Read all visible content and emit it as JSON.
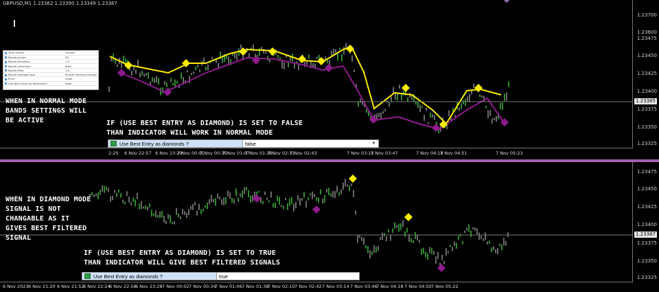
{
  "symbol": "GBPUSD,M1  1.23362 1.23390 1.23349 1.23387",
  "top_chart": {
    "price_labels": [
      "1.23700",
      "1.23600",
      "1.23475",
      "1.23450",
      "1.23425",
      "1.23400",
      "1.23375",
      "1.23350",
      "1.23325"
    ],
    "current_price": "1.23385",
    "time_labels": [
      "2:25",
      "6 Nov 22:57",
      "6 Nov 23:29",
      "7 Nov 00:01",
      "7 Nov 00:35",
      "7 Nov 01:07",
      "7 Nov 01:39",
      "7 Nov 02:11",
      "7 Nov 02:43",
      "7 Nov 03:15",
      "7 Nov 03:47",
      "7 Nov 04:19",
      "7 Nov 04:51",
      "7 Nov 05:23"
    ]
  },
  "bottom_chart": {
    "price_labels": [
      "1.23475",
      "1.23450",
      "1.23425",
      "1.23400",
      "1.23375",
      "1.23350",
      "1.23325"
    ],
    "current_price": "1.23387",
    "time_labels": [
      "6 Nov 2023",
      "6 Nov 21:20",
      "6 Nov 21:52",
      "6 Nov 22:24",
      "6 Nov 22:56",
      "6 Nov 23:28",
      "7 Nov 00:02",
      "7 Nov 00:34",
      "7 Nov 01:06",
      "7 Nov 01:38",
      "7 Nov 02:10",
      "7 Nov 02:42",
      "7 Nov 03:14",
      "7 Nov 03:46",
      "7 Nov 04:18",
      "7 Nov 04:50",
      "7 Nov 05:22"
    ]
  },
  "settings_table": [
    {
      "k": "Time Frame",
      "v": "current"
    },
    {
      "k": "Bands period",
      "v": "20"
    },
    {
      "k": "Bands Deviation",
      "v": "1.5"
    },
    {
      "k": "Bands correction",
      "v": "false"
    },
    {
      "k": "Bands Filter",
      "v": "1.0"
    },
    {
      "k": "Bands average type",
      "v": "Simple moving average"
    },
    {
      "k": "Price",
      "v": "Close"
    },
    {
      "k": "Use Best Entry as diamonds ?",
      "v": "false"
    }
  ],
  "notes": {
    "normal_mode": [
      "WHEN IN NORMAL MODE",
      "BANDS SETTINGS WILL",
      "BE ACTIVE"
    ],
    "false_msg": [
      "IF (USE BEST ENTRY AS DIAMOND) IS SET TO FALSE",
      "THAN INDICATOR WILL WORK IN NORMAL MODE"
    ],
    "diamond_mode": [
      "WHEN IN DIAMOND MODE",
      "SIGNAL IS NOT",
      "CHANGABLE AS IT",
      "GIVES BEST FILTERED",
      "SIGNAL"
    ],
    "true_msg": [
      "IF (USE BEST ENTRY AS DIAMOND) IS SET TO TRUE",
      "THAN INDICATOR WILL GIVE BEST FILTERED SIGNALS"
    ]
  },
  "option_top": {
    "label": "Use Best Entry as diamonds ?",
    "value": "false"
  },
  "option_bottom": {
    "label": "Use Best Entry as diamonds ?",
    "value": "true"
  },
  "colors": {
    "bull": "#2f8a2f",
    "bear": "#6a6a6a",
    "band_up": "#ffee00",
    "band_dn": "#8e1a8e",
    "diamond_yellow": "#ffee00",
    "diamond_purple": "#8e1a8e",
    "separator": "#a060b0"
  }
}
